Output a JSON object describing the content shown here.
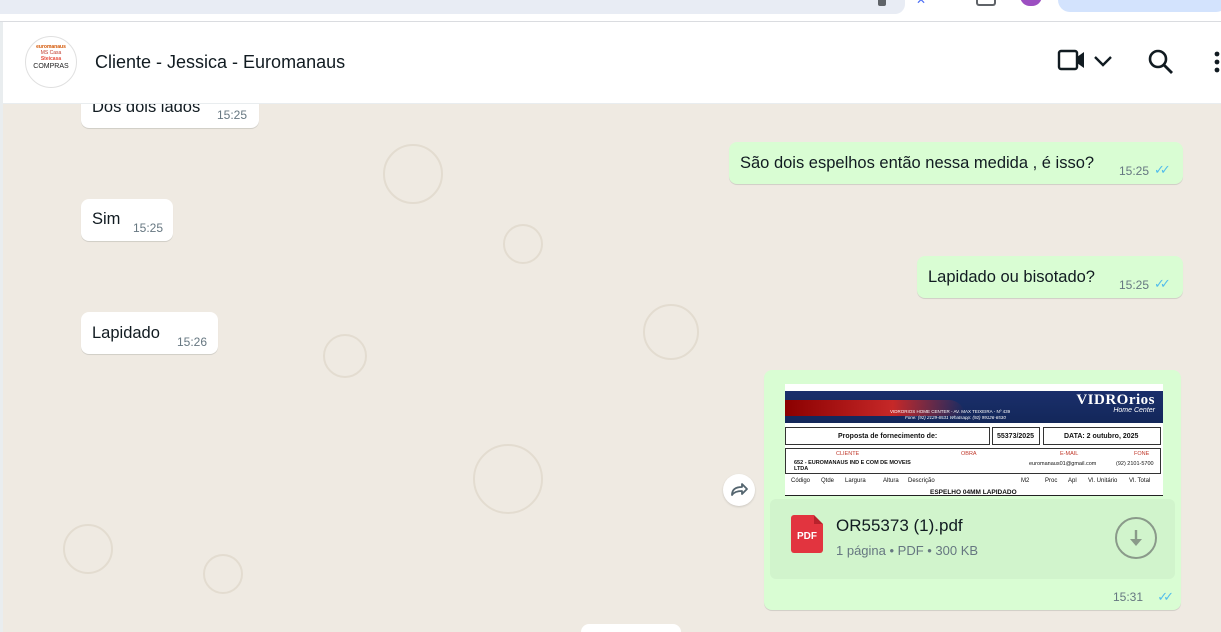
{
  "chat": {
    "title": "Cliente - Jessica - Euromanaus",
    "avatar": {
      "line1": "euromanaus",
      "line2": "MS Casa",
      "line3": "Steicasa",
      "line4": "COMPRAS"
    }
  },
  "messages": [
    {
      "dir": "in",
      "text": "Dos dois lados",
      "time": "15:25"
    },
    {
      "dir": "out",
      "text": "São dois espelhos então nessa medida , é isso?",
      "time": "15:25"
    },
    {
      "dir": "in",
      "text": "Sim",
      "time": "15:25"
    },
    {
      "dir": "out",
      "text": "Lapidado ou bisotado?",
      "time": "15:25"
    },
    {
      "dir": "in",
      "text": "Lapidado",
      "time": "15:26"
    }
  ],
  "document": {
    "filename": "OR55373 (1).pdf",
    "meta": "1 página • PDF • 300 KB",
    "time": "15:31",
    "icon_label": "PDF",
    "preview": {
      "brand": "VIDROrios",
      "brand_sub": "Home Center",
      "address": "VIDRORIOS HOME CENTER - AV. MAX TEIXEIRA - Nº 439",
      "phones": "Fone: (92) 2129-6531  Whatsapp: (92) 99126-6530",
      "proposal_label": "Proposta de fornecimento de:",
      "proposal_number": "55373/2025",
      "date": "DATA: 2 outubro, 2025",
      "headers": [
        "CLIENTE",
        "OBRA",
        "E-MAIL",
        "FONE"
      ],
      "client": "652 - EUROMANAUS IND E COM DE MOVEIS LTDA",
      "email": "euromanaus01@gmail.com",
      "phone": "(92) 2101-5700",
      "columns": [
        "Código",
        "Qtde",
        "Largura",
        "Altura",
        "Descrição",
        "M2",
        "Proc",
        "Apl",
        "Vl. Unitário",
        "Vl. Total"
      ],
      "item": "ESPELHO 04MM LAPIDADO"
    }
  },
  "colors": {
    "incoming": "#ffffff",
    "outgoing": "#d9fdd3",
    "ticks": "#53bdeb",
    "background": "#efeae2"
  }
}
